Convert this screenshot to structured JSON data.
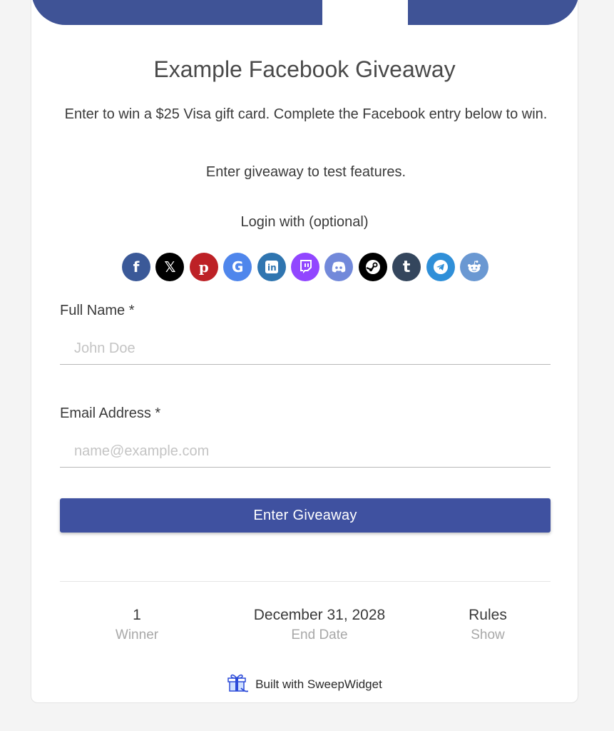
{
  "giveaway": {
    "title": "Example Facebook Giveaway",
    "description": "Enter to win a $25 Visa gift card. Complete the Facebook entry below to win.",
    "note": "Enter giveaway to test features."
  },
  "login": {
    "label": "Login with (optional)",
    "providers": [
      {
        "name": "facebook",
        "color": "#3b5998"
      },
      {
        "name": "x",
        "color": "#000000"
      },
      {
        "name": "pinterest",
        "color": "#bd2126"
      },
      {
        "name": "google",
        "color": "#4f86ec"
      },
      {
        "name": "linkedin",
        "color": "#2f75b0"
      },
      {
        "name": "twitch",
        "color": "#9146ff"
      },
      {
        "name": "discord",
        "color": "#7289da"
      },
      {
        "name": "steam",
        "color": "#000000"
      },
      {
        "name": "tumblr",
        "color": "#34465d"
      },
      {
        "name": "telegram",
        "color": "#2f8fd8"
      },
      {
        "name": "reddit",
        "color": "#6a98d2"
      }
    ]
  },
  "form": {
    "full_name": {
      "label": "Full Name *",
      "placeholder": "John Doe",
      "value": ""
    },
    "email": {
      "label": "Email Address *",
      "placeholder": "name@example.com",
      "value": ""
    },
    "submit_label": "Enter Giveaway"
  },
  "stats": {
    "winners": {
      "value": "1",
      "label": "Winner"
    },
    "end_date": {
      "value": "December 31, 2028",
      "label": "End Date"
    },
    "rules": {
      "value": "Rules",
      "label": "Show"
    }
  },
  "footer": {
    "text": "Built with SweepWidget"
  },
  "colors": {
    "brand": "#3f5396",
    "button": "#3f51a0"
  }
}
